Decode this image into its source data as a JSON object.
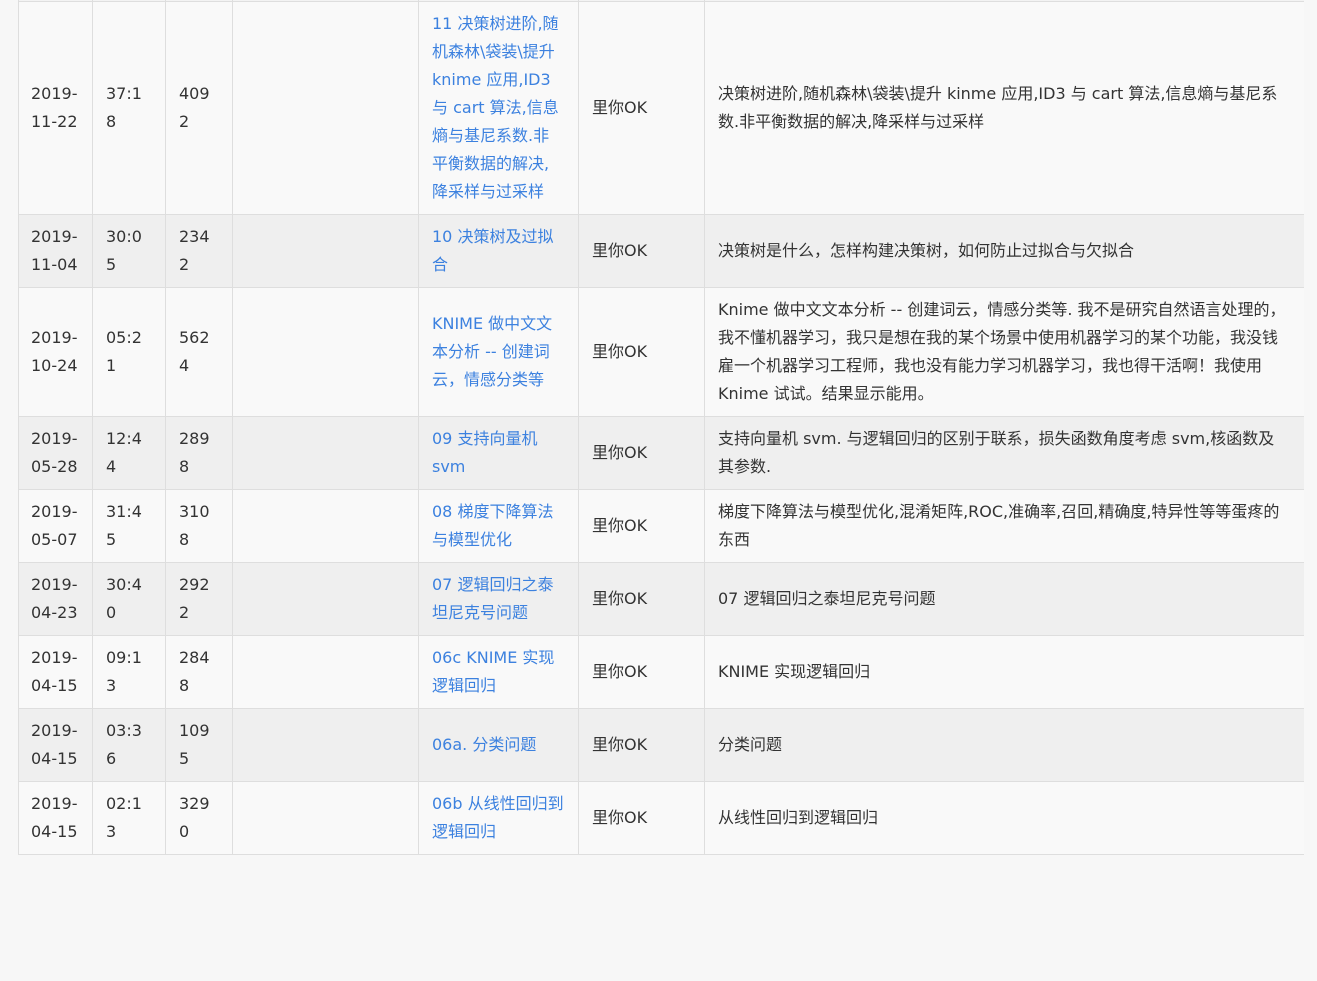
{
  "rows": [
    {
      "date": "2019-11-22",
      "duration": "37:18",
      "views": "4092",
      "title": "11 决策树进阶,随机森林\\袋装\\提升 knime 应用,ID3 与 cart 算法,信息熵与基尼系数.非平衡数据的解决,降采样与过采样",
      "author": "里你OK",
      "description": "决策树进阶,随机森林\\袋装\\提升 kinme 应用,ID3 与 cart 算法,信息熵与基尼系数.非平衡数据的解决,降采样与过采样"
    },
    {
      "date": "2019-11-04",
      "duration": "30:05",
      "views": "2342",
      "title": "10 决策树及过拟合",
      "author": "里你OK",
      "description": "决策树是什么，怎样构建决策树，如何防止过拟合与欠拟合"
    },
    {
      "date": "2019-10-24",
      "duration": "05:21",
      "views": "5624",
      "title": "KNIME 做中文文本分析 -- 创建词云，情感分类等",
      "author": "里你OK",
      "description": "Knime 做中文文本分析 -- 创建词云，情感分类等. 我不是研究自然语言处理的，我不懂机器学习，我只是想在我的某个场景中使用机器学习的某个功能，我没钱雇一个机器学习工程师，我也没有能力学习机器学习，我也得干活啊！我使用 Knime 试试。结果显示能用。"
    },
    {
      "date": "2019-05-28",
      "duration": "12:44",
      "views": "2898",
      "title": "09 支持向量机 svm",
      "author": "里你OK",
      "description": "支持向量机 svm. 与逻辑回归的区别于联系，损失函数角度考虑 svm,核函数及其参数."
    },
    {
      "date": "2019-05-07",
      "duration": "31:45",
      "views": "3108",
      "title": "08 梯度下降算法与模型优化",
      "author": "里你OK",
      "description": "梯度下降算法与模型优化,混淆矩阵,ROC,准确率,召回,精确度,特异性等等蛋疼的东西"
    },
    {
      "date": "2019-04-23",
      "duration": "30:40",
      "views": "2922",
      "title": "07 逻辑回归之泰坦尼克号问题",
      "author": "里你OK",
      "description": "07 逻辑回归之泰坦尼克号问题"
    },
    {
      "date": "2019-04-15",
      "duration": "09:13",
      "views": "2848",
      "title": "06c KNIME 实现逻辑回归",
      "author": "里你OK",
      "description": "KNIME 实现逻辑回归"
    },
    {
      "date": "2019-04-15",
      "duration": "03:36",
      "views": "1095",
      "title": "06a. 分类问题",
      "author": "里你OK",
      "description": "分类问题"
    },
    {
      "date": "2019-04-15",
      "duration": "02:13",
      "views": "3290",
      "title": "06b 从线性回归到逻辑回归",
      "author": "里你OK",
      "description": "从线性回归到逻辑回归"
    }
  ]
}
